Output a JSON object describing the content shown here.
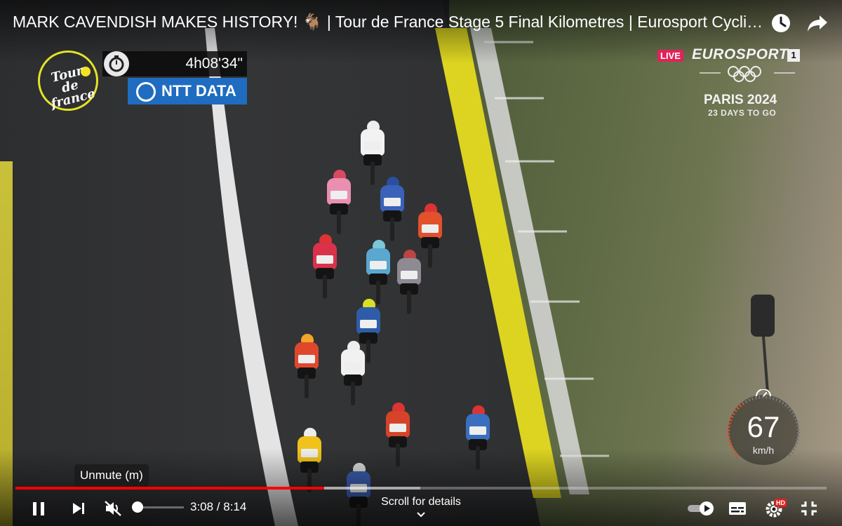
{
  "video": {
    "title": "MARK CAVENDISH MAKES HISTORY! 🐐 | Tour de France Stage 5 Final Kilometres | Eurosport Cycling"
  },
  "overlay": {
    "logo_text": "Tour de france",
    "race_time": "4h08'34\"",
    "sponsor": "NTT DATA",
    "live_badge": "LIVE",
    "channel": "EUROSPORT",
    "channel_number": "1",
    "olympics_event": "PARIS 2024",
    "countdown": "23 DAYS TO GO",
    "speed_value": "67",
    "speed_unit": "km/h"
  },
  "player": {
    "tooltip": "Unmute (m)",
    "time_display": "3:08 / 8:14",
    "scroll_hint": "Scroll for details",
    "progress_played_fraction": 0.381,
    "progress_buffered_fraction": 0.499,
    "volume_fraction": 0,
    "hd_badge": "HD"
  },
  "icons": [
    "watch-later-icon",
    "share-icon",
    "stopwatch-icon",
    "play-pause-icon",
    "next-icon",
    "mute-icon",
    "autoplay-toggle-icon",
    "subtitles-icon",
    "settings-icon",
    "fullscreen-icon",
    "chevron-down-icon"
  ],
  "colors": {
    "progress_red": "#ff0000",
    "live_pink": "#e0225a",
    "sponsor_blue": "#1f6cc0",
    "logo_yellow": "#e3e326"
  }
}
